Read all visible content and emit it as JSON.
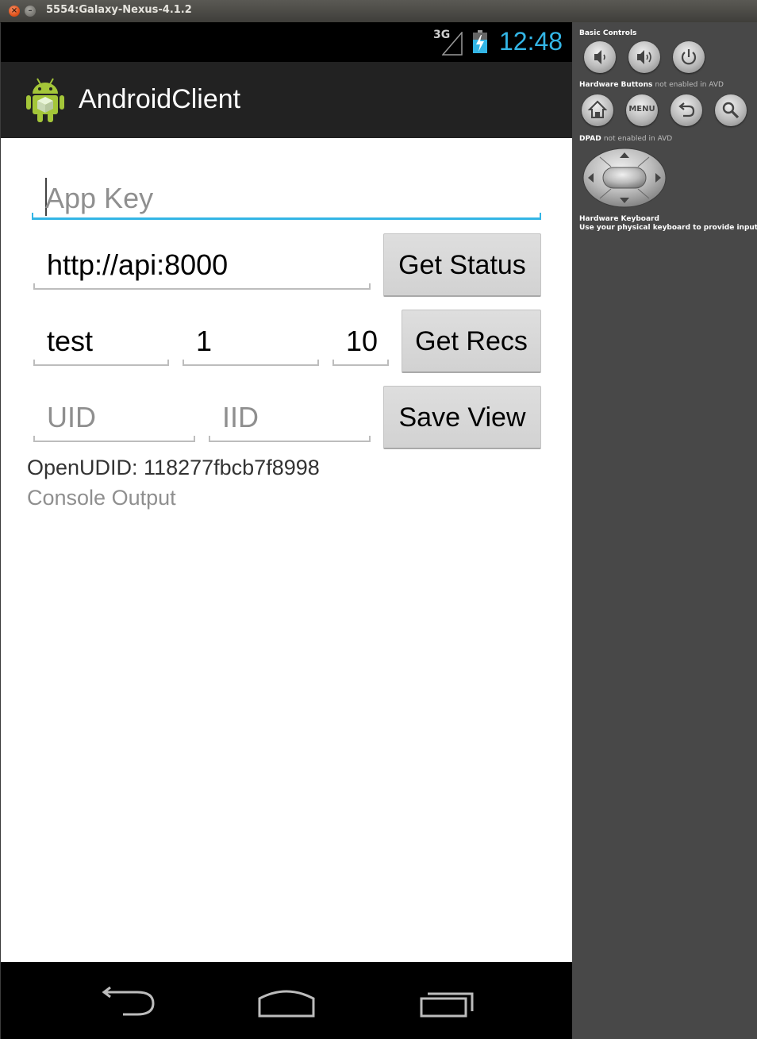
{
  "window": {
    "title": "5554:Galaxy-Nexus-4.1.2",
    "close_glyph": "×",
    "minimize_glyph": "–"
  },
  "statusbar": {
    "network": "3G",
    "time": "12:48",
    "accent_color": "#33b5e5"
  },
  "actionbar": {
    "app_name": "AndroidClient",
    "icon": "android-robot-icon"
  },
  "form": {
    "app_key_placeholder": "App Key",
    "server_url": "http://api:8000",
    "get_status_label": "Get Status",
    "rec_user": "test",
    "rec_start": "1",
    "rec_count": "10",
    "get_recs_label": "Get Recs",
    "uid_placeholder": "UID",
    "iid_placeholder": "IID",
    "save_view_label": "Save View"
  },
  "info": {
    "openudid": "OpenUDID: 118277fbcb7f8998",
    "console": "Console Output"
  },
  "navbar": {
    "icons": [
      "back-icon",
      "home-icon",
      "recent-apps-icon"
    ]
  },
  "panel": {
    "basic_controls": "Basic Controls",
    "hardware_buttons": "Hardware Buttons",
    "hardware_buttons_note": "not enabled in AVD",
    "menu_label": "MENU",
    "dpad": "DPAD",
    "dpad_note": "not enabled in AVD",
    "hardware_keyboard": "Hardware Keyboard",
    "hardware_keyboard_note": "Use your physical keyboard to provide input"
  }
}
